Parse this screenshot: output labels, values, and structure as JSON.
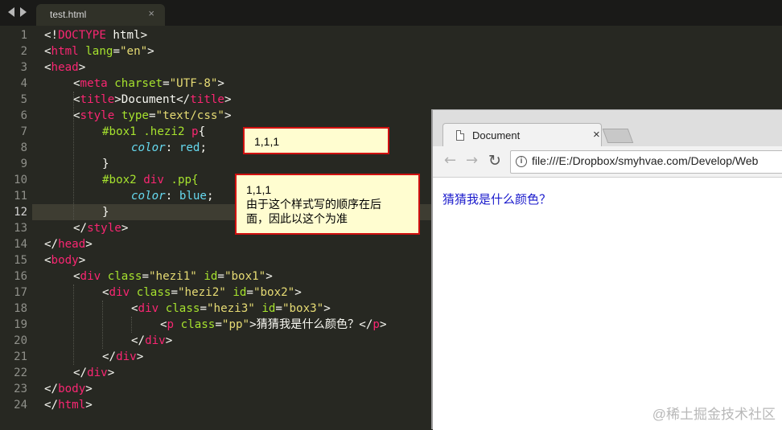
{
  "editor": {
    "tab_title": "test.html",
    "tab_close": "×",
    "line_numbers": [
      "1",
      "2",
      "3",
      "4",
      "5",
      "6",
      "7",
      "8",
      "9",
      "10",
      "11",
      "12",
      "13",
      "14",
      "15",
      "16",
      "17",
      "18",
      "19",
      "20",
      "21",
      "22",
      "23",
      "24"
    ]
  },
  "code": {
    "l1": {
      "a": "<!",
      "b": "DOCTYPE",
      "c": " html>"
    },
    "l2": {
      "a": "<",
      "b": "html",
      "c": " ",
      "d": "lang",
      "e": "=",
      "f": "\"en\"",
      "g": ">"
    },
    "l3": {
      "a": "<",
      "b": "head",
      "c": ">"
    },
    "l4": {
      "a": "<",
      "b": "meta",
      "c": " ",
      "d": "charset",
      "e": "=",
      "f": "\"UTF-8\"",
      "g": ">"
    },
    "l5": {
      "a": "<",
      "b": "title",
      "c": ">Document</",
      "d": "title",
      "e": ">"
    },
    "l6": {
      "a": "<",
      "b": "style",
      "c": " ",
      "d": "type",
      "e": "=",
      "f": "\"text/css\"",
      "g": ">"
    },
    "l7": {
      "a": "#box1 .hezi2 ",
      "b": "p",
      "c": "{"
    },
    "l8": {
      "a": "color",
      "b": ": ",
      "c": "red",
      "d": ";"
    },
    "l9": {
      "a": "}"
    },
    "l10": {
      "a": "#box2 ",
      "b": "div",
      "c": " .pp{"
    },
    "l11": {
      "a": "color",
      "b": ": ",
      "c": "blue",
      "d": ";"
    },
    "l12": {
      "a": "}"
    },
    "l13": {
      "a": "</",
      "b": "style",
      "c": ">"
    },
    "l14": {
      "a": "</",
      "b": "head",
      "c": ">"
    },
    "l15": {
      "a": "<",
      "b": "body",
      "c": ">"
    },
    "l16": {
      "a": "<",
      "b": "div",
      "c": " ",
      "d": "class",
      "e": "=",
      "f": "\"hezi1\"",
      "g": " ",
      "h": "id",
      "i": "=",
      "j": "\"box1\"",
      "k": ">"
    },
    "l17": {
      "a": "<",
      "b": "div",
      "c": " ",
      "d": "class",
      "e": "=",
      "f": "\"hezi2\"",
      "g": " ",
      "h": "id",
      "i": "=",
      "j": "\"box2\"",
      "k": ">"
    },
    "l18": {
      "a": "<",
      "b": "div",
      "c": " ",
      "d": "class",
      "e": "=",
      "f": "\"hezi3\"",
      "g": " ",
      "h": "id",
      "i": "=",
      "j": "\"box3\"",
      "k": ">"
    },
    "l19": {
      "a": "<",
      "b": "p",
      "c": " ",
      "d": "class",
      "e": "=",
      "f": "\"pp\"",
      "g": ">猜猜我是什么颜色？</",
      "h": "p",
      "i": ">"
    },
    "l20": {
      "a": "</",
      "b": "div",
      "c": ">"
    },
    "l21": {
      "a": "</",
      "b": "div",
      "c": ">"
    },
    "l22": {
      "a": "</",
      "b": "div",
      "c": ">"
    },
    "l23": {
      "a": "</",
      "b": "body",
      "c": ">"
    },
    "l24": {
      "a": "</",
      "b": "html",
      "c": ">"
    }
  },
  "annotations": {
    "note1": "1,1,1",
    "note2_line1": "1,1,1",
    "note2_line2": "由于这个样式写的顺序在后",
    "note2_line3": "面，因此以这个为准"
  },
  "browser": {
    "tab_title": "Document",
    "tab_close": "×",
    "back": "←",
    "forward": "→",
    "reload": "↻",
    "info": "i",
    "url": "file:///E:/Dropbox/smyhvae.com/Develop/Web",
    "content_text": "猜猜我是什么颜色？"
  },
  "watermark": "@稀土掘金技术社区",
  "colors": {
    "red": "#d01010",
    "content_blue": "#1a1acc",
    "editor_bg": "#272822"
  }
}
